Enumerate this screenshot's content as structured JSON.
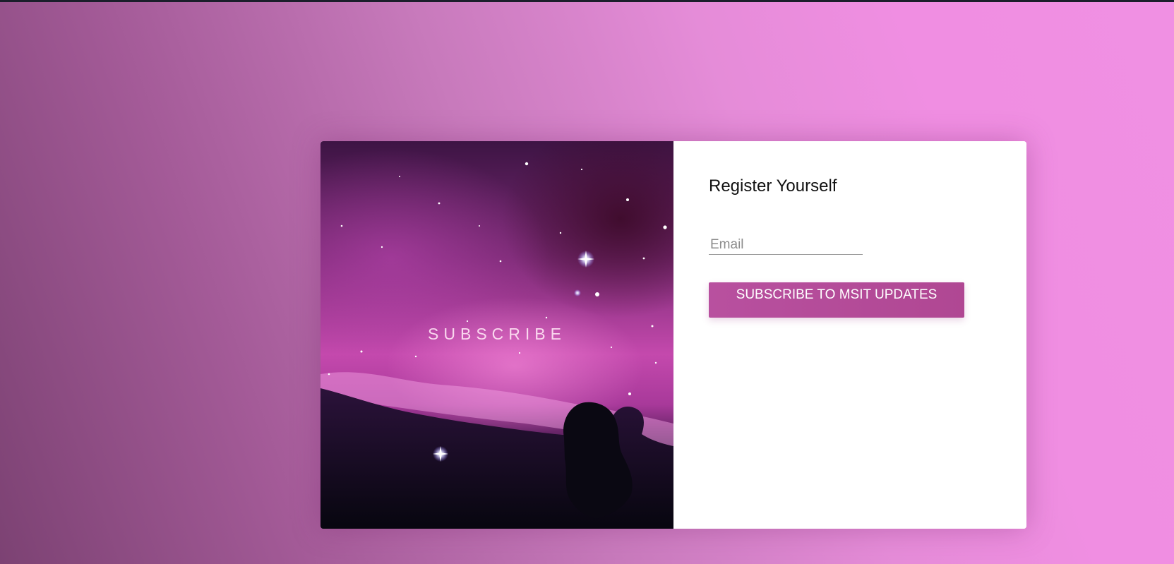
{
  "hero": {
    "title": "SUBSCRIBE",
    "image": "horsehead-nebula-starfield"
  },
  "form": {
    "title": "Register Yourself",
    "email_placeholder": "Email",
    "email_value": "",
    "subscribe_label": "SUBSCRIBE TO MSIT UPDATES"
  },
  "colors": {
    "background_start": "#7c4273",
    "background_end": "#f090e3",
    "button": "#b44b99",
    "card": "#ffffff"
  }
}
